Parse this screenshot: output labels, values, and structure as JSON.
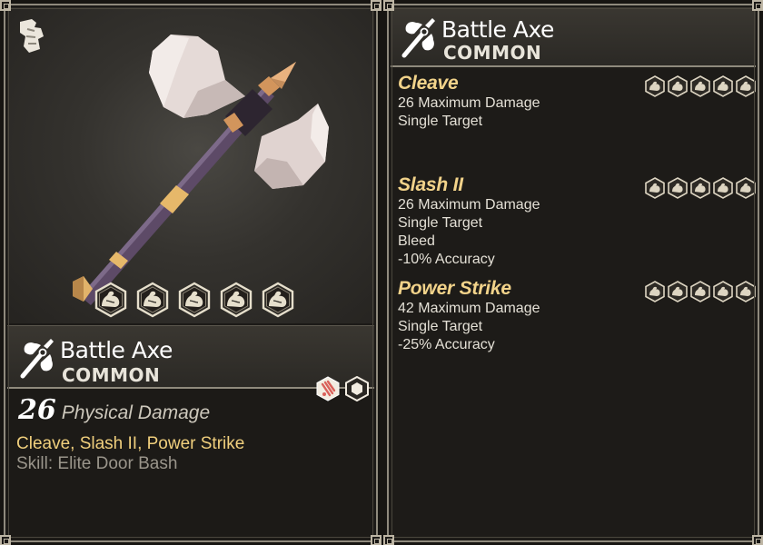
{
  "item": {
    "name": "Battle Axe",
    "rarity": "COMMON",
    "damage_value": "26",
    "damage_label": "Physical Damage",
    "abilities_summary": "Cleave, Slash II, Power Strike",
    "skill_line": "Skill: Elite Door Bash",
    "strength_requirement_icons": 5
  },
  "icons": {
    "preview_glyph": "armor-slot-icon",
    "title_icon": "battle-axe-icon",
    "strength": "flexed-arm-icon",
    "damage_type_1": "bleed-slash-icon",
    "damage_type_2": "hexagon-nut-icon"
  },
  "colors": {
    "ability_name": "#f2d38a",
    "abilities_summary": "#f0cf7d",
    "skill_text": "#9a958b",
    "panel_border": "#8f8a7d",
    "bleed_icon": "#d9605a"
  },
  "abilities": [
    {
      "name": "Cleave",
      "lines": [
        "26 Maximum Damage",
        "Single Target"
      ],
      "icon_count": 5
    },
    {
      "name": "Slash II",
      "lines": [
        "26 Maximum Damage",
        "Single Target",
        "Bleed",
        "-10% Accuracy"
      ],
      "icon_count": 5
    },
    {
      "name": "Power Strike",
      "lines": [
        "42 Maximum Damage",
        "Single Target",
        "-25% Accuracy"
      ],
      "icon_count": 5
    }
  ]
}
